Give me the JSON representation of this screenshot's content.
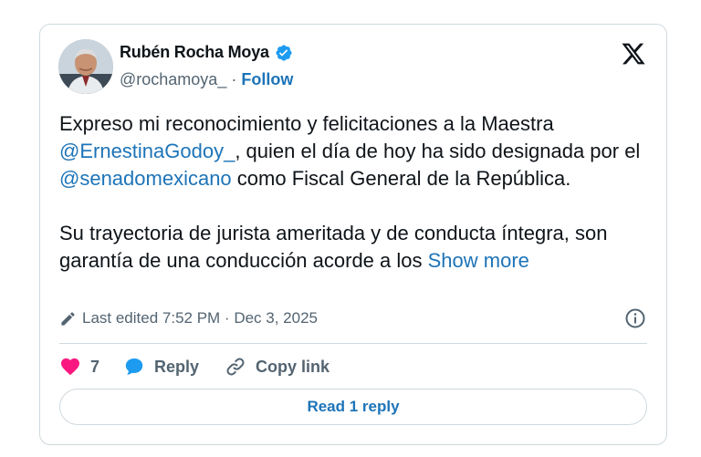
{
  "author": {
    "display_name": "Rubén Rocha Moya",
    "handle": "@rochamoya_",
    "separator": "·",
    "follow_label": "Follow",
    "verified_icon": "verified-badge-icon"
  },
  "tweet": {
    "line1_a": "Expreso mi reconocimiento y felicitaciones a la Maestra ",
    "mention1": "@ErnestinaGodoy_",
    "line1_b": ", quien el día de hoy ha sido designada por el ",
    "mention2": "@senadomexicano",
    "line1_c": " como Fiscal General de la República.",
    "paragraph2": "Su trayectoria de jurista ameritada y de conducta íntegra, son garantía de una conducción acorde a los ",
    "show_more": "Show more"
  },
  "meta": {
    "last_edited": "Last edited 7:52 PM · Dec 3, 2025"
  },
  "actions": {
    "like_count": "7",
    "reply_label": "Reply",
    "copy_link_label": "Copy link"
  },
  "footer": {
    "read_reply_label": "Read 1 reply"
  },
  "colors": {
    "link": "#1d74b8",
    "muted": "#536471",
    "like": "#f91880",
    "border": "#cfd9de"
  }
}
